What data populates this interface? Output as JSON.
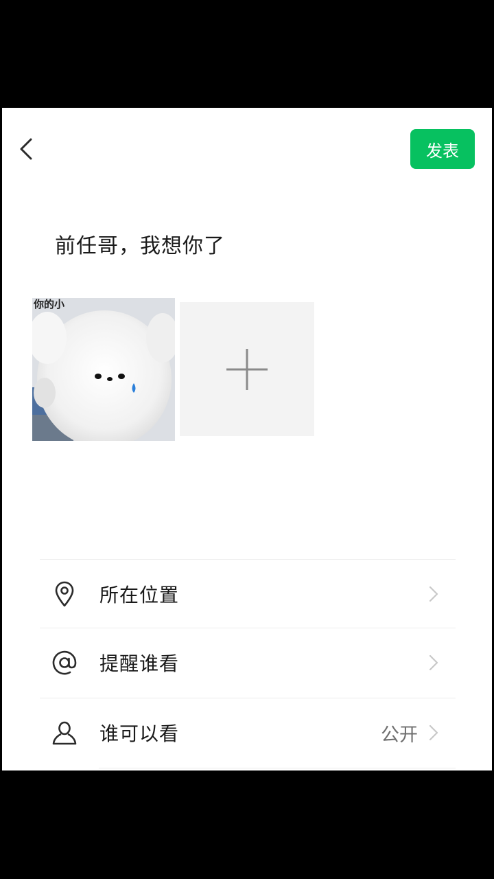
{
  "header": {
    "back_icon": "chevron-left-icon",
    "publish_label": "发表",
    "accent": "#07c160"
  },
  "post": {
    "text": "前任哥，我想你了",
    "image_overlay_text": "你的小",
    "add_photo_icon": "plus-icon"
  },
  "menu": {
    "items": [
      {
        "label": "所在位置",
        "icon": "location-pin-icon",
        "value": ""
      },
      {
        "label": "提醒谁看",
        "icon": "at-sign-icon",
        "value": ""
      },
      {
        "label": "谁可以看",
        "icon": "person-icon",
        "value": "公开"
      }
    ]
  }
}
